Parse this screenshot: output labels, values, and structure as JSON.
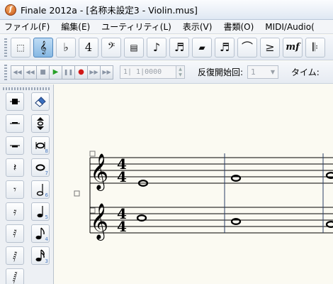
{
  "window": {
    "title": "Finale 2012a - [名称未設定3 - Violin.mus]",
    "app_icon_letter": "f"
  },
  "menu": [
    "ファイル(F)",
    "編集(E)",
    "ユーティリティ(L)",
    "表示(V)",
    "書類(O)",
    "MIDI/Audio("
  ],
  "toolbar": {
    "tools": [
      {
        "name": "selection-tool",
        "glyph": "⬚"
      },
      {
        "name": "staff-tool",
        "glyph": "𝄞",
        "active": true
      },
      {
        "name": "key-signature-tool",
        "glyph": "♭"
      },
      {
        "name": "time-signature-tool",
        "glyph": "4"
      },
      {
        "name": "clef-tool",
        "glyph": "𝄢"
      },
      {
        "name": "measure-tool",
        "glyph": "▤"
      },
      {
        "name": "simple-entry-tool",
        "glyph": "♪"
      },
      {
        "name": "speedy-entry-tool",
        "glyph": "♬"
      },
      {
        "name": "hyper-scribe-tool",
        "glyph": "▰"
      },
      {
        "name": "tuplet-tool",
        "glyph": "♬"
      },
      {
        "name": "smart-shape-tool",
        "glyph": "⌒"
      },
      {
        "name": "articulation-tool",
        "glyph": "≥"
      },
      {
        "name": "expression-tool",
        "glyph": "mf"
      },
      {
        "name": "repeat-tool",
        "glyph": "𝄆"
      }
    ]
  },
  "playback": {
    "measure_value": "1| 1|0000",
    "repeat_label": "反復開始回:",
    "repeat_value": "1",
    "time_label": "タイム:"
  },
  "palette": {
    "left": [
      {
        "name": "whole-rest",
        "glyph": "▬"
      },
      {
        "name": "half-rest",
        "glyph": "▬"
      },
      {
        "name": "rest-bar",
        "glyph": "▬"
      },
      {
        "name": "quarter-rest",
        "glyph": "𝄽"
      },
      {
        "name": "eighth-rest",
        "glyph": "𝄾"
      },
      {
        "name": "sixteenth-rest",
        "glyph": "𝄿"
      },
      {
        "name": "thirtysecond-rest",
        "glyph": "𝅀"
      },
      {
        "name": "sixtyfourth-rest",
        "glyph": "𝅁"
      },
      {
        "name": "128th-rest",
        "glyph": "𝅂"
      }
    ],
    "right": [
      {
        "name": "eraser",
        "glyph": "⌫",
        "num": ""
      },
      {
        "name": "pitch-up-down",
        "glyph": "⇕",
        "num": ""
      },
      {
        "name": "double-whole-note",
        "glyph": "𝅜",
        "num": "8"
      },
      {
        "name": "whole-note",
        "glyph": "𝅝",
        "num": "7"
      },
      {
        "name": "half-note",
        "glyph": "𝅗𝅥",
        "num": "6"
      },
      {
        "name": "quarter-note",
        "glyph": "♩",
        "num": "5"
      },
      {
        "name": "eighth-note",
        "glyph": "♪",
        "num": "4"
      },
      {
        "name": "sixteenth-note",
        "glyph": "♬",
        "num": "3"
      }
    ]
  },
  "score": {
    "time_signature": [
      "4",
      "4"
    ],
    "clef_glyph": "𝄞"
  }
}
